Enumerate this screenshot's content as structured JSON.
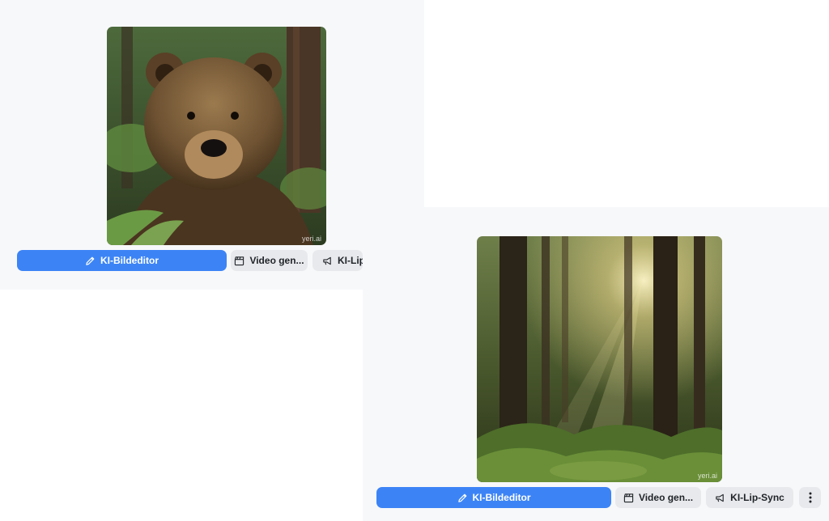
{
  "cards": [
    {
      "image_subject": "grizzly bear in forest",
      "watermark": "yeri.ai",
      "actions": {
        "primary_label": "KI-Bildeditor",
        "video_label": "Video gen...",
        "lipsync_label": "KI-Lip-S"
      }
    },
    {
      "image_subject": "sunlit forest with tall trees and ferns",
      "watermark": "yeri.ai",
      "actions": {
        "primary_label": "KI-Bildeditor",
        "video_label": "Video gen...",
        "lipsync_label": "KI-Lip-Sync"
      }
    }
  ],
  "icons": {
    "primary": "pencil-icon",
    "video": "clapperboard-icon",
    "lipsync": "megaphone-icon",
    "more": "more-vertical-icon"
  },
  "colors": {
    "primary_button": "#3c84f6",
    "secondary_button": "#e8e9ec",
    "panel_background": "#f7f8fa"
  }
}
